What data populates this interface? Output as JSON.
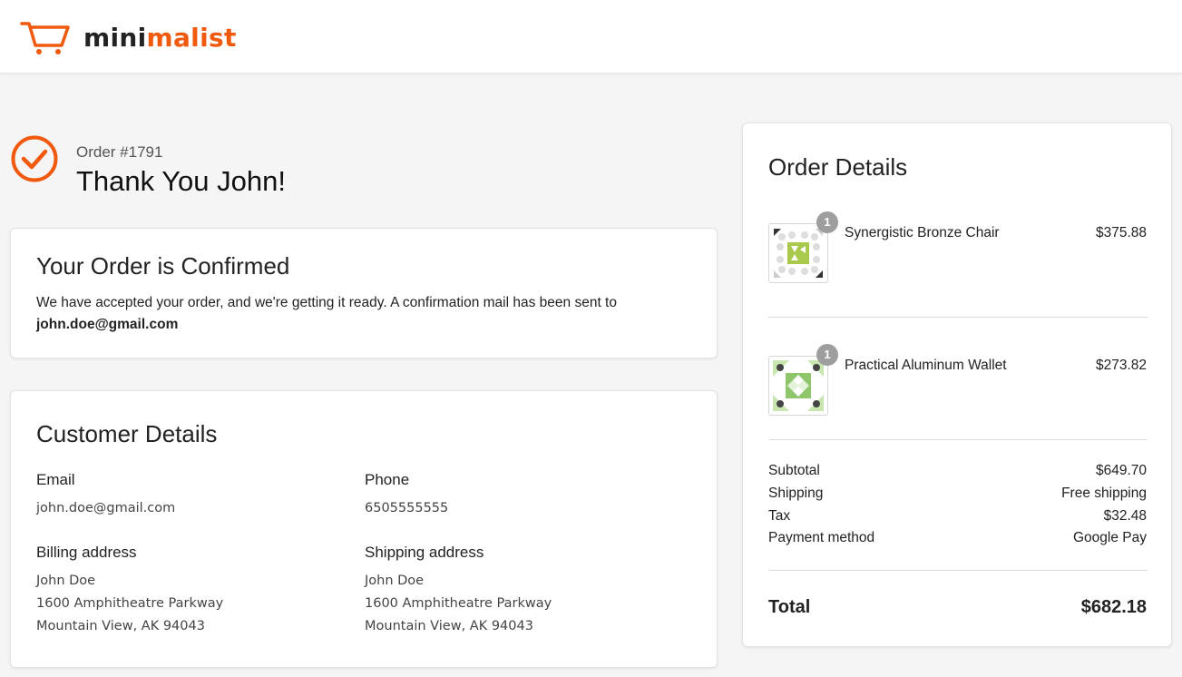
{
  "brand": {
    "part1": "mini",
    "part2": "malist",
    "accent_color": "#f05a0e"
  },
  "header_icons": {
    "cart": "shopping-cart-icon"
  },
  "order": {
    "number": "Order #1791",
    "greeting": "Thank You John!"
  },
  "confirmation": {
    "title": "Your Order is Confirmed",
    "message": "We have accepted your order, and we're getting it ready. A confirmation mail has been sent to",
    "email": "john.doe@gmail.com"
  },
  "customer": {
    "title": "Customer Details",
    "email_label": "Email",
    "email": "john.doe@gmail.com",
    "phone_label": "Phone",
    "phone": "6505555555",
    "billing_label": "Billing address",
    "billing": {
      "name": "John Doe",
      "line1": "1600 Amphitheatre Parkway",
      "line2": "Mountain View, AK 94043"
    },
    "shipping_label": "Shipping address",
    "shipping": {
      "name": "John Doe",
      "line1": "1600 Amphitheatre Parkway",
      "line2": "Mountain View, AK 94043"
    }
  },
  "order_details": {
    "title": "Order Details",
    "items": [
      {
        "name": "Synergistic Bronze Chair",
        "price": "$375.88",
        "quantity": "1"
      },
      {
        "name": "Practical Aluminum Wallet",
        "price": "$273.82",
        "quantity": "1"
      }
    ],
    "summary": [
      {
        "label": "Subtotal",
        "value": "$649.70"
      },
      {
        "label": "Shipping",
        "value": "Free shipping"
      },
      {
        "label": "Tax",
        "value": "$32.48"
      },
      {
        "label": "Payment method",
        "value": "Google Pay"
      }
    ],
    "total_label": "Total",
    "total_value": "$682.18"
  }
}
